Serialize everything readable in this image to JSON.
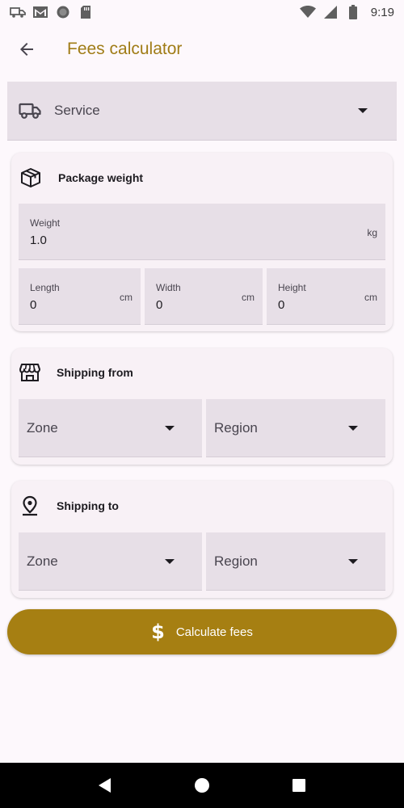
{
  "status_bar": {
    "time": "9:19",
    "icons": [
      "truck-icon",
      "gmail-icon",
      "circle-icon",
      "sd-card-icon",
      "wifi-icon",
      "signal-icon",
      "battery-icon"
    ]
  },
  "app_bar": {
    "title": "Fees calculator",
    "back_icon": "arrow-back-icon"
  },
  "service": {
    "label": "Service",
    "icon": "truck-icon"
  },
  "package_weight": {
    "title": "Package weight",
    "icon": "box-icon",
    "weight": {
      "label": "Weight",
      "value": "1.0",
      "unit": "kg"
    },
    "length": {
      "label": "Length",
      "value": "0",
      "unit": "cm"
    },
    "width": {
      "label": "Width",
      "value": "0",
      "unit": "cm"
    },
    "height": {
      "label": "Height",
      "value": "0",
      "unit": "cm"
    }
  },
  "shipping_from": {
    "title": "Shipping from",
    "icon": "store-icon",
    "zone_label": "Zone",
    "region_label": "Region"
  },
  "shipping_to": {
    "title": "Shipping to",
    "icon": "location-pin-icon",
    "zone_label": "Zone",
    "region_label": "Region"
  },
  "calculate_button": {
    "label": "Calculate fees",
    "icon": "dollar-icon"
  },
  "colors": {
    "accent": "#a67f12",
    "title": "#a07c16",
    "field_bg": "#e7dfe7",
    "card_bg": "#f8f1f6",
    "page_bg": "#fdf8fc"
  }
}
